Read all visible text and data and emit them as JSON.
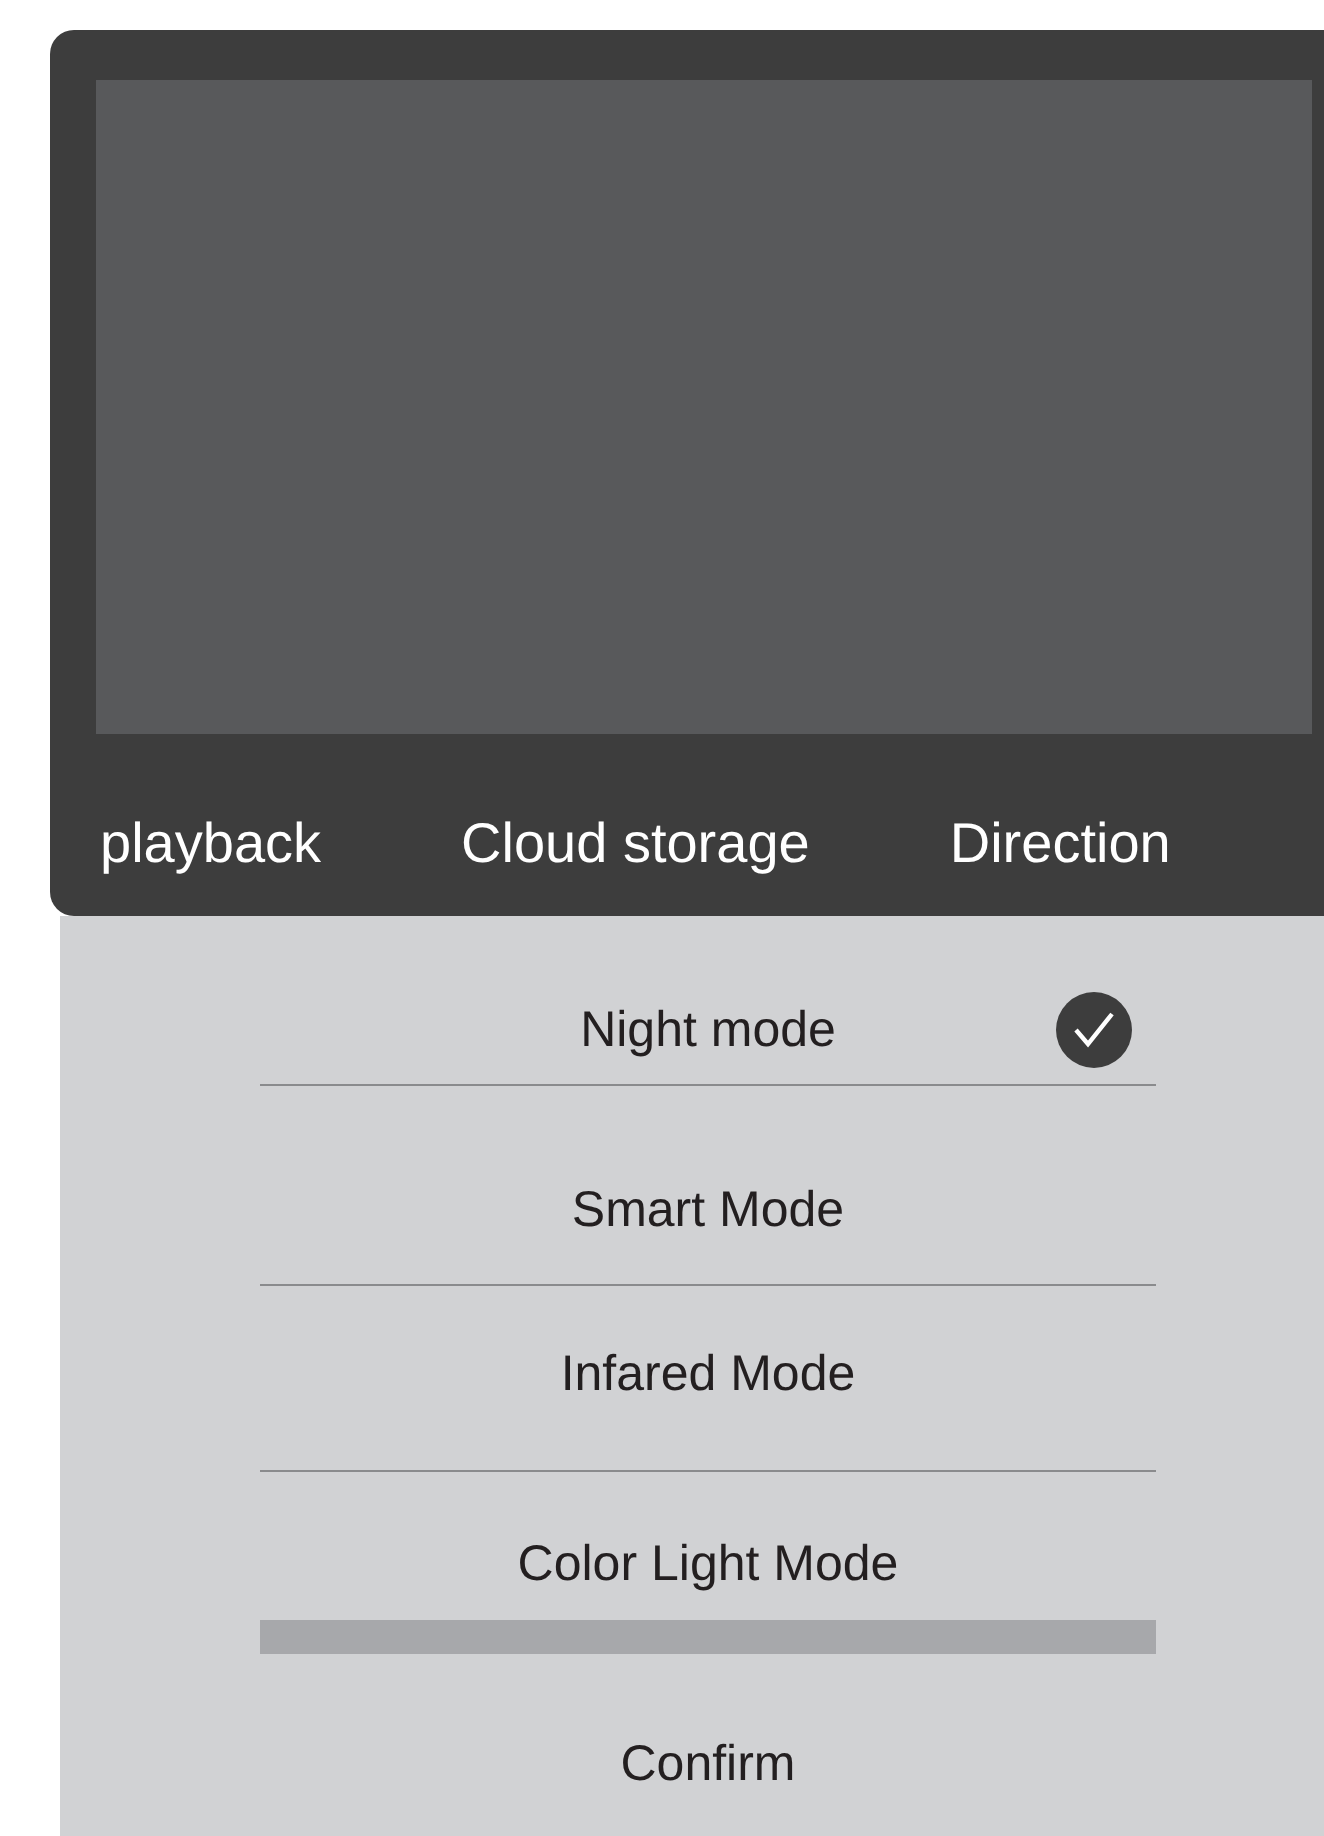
{
  "tabs": [
    {
      "label": "playback"
    },
    {
      "label": "Cloud storage"
    },
    {
      "label": "Direction"
    }
  ],
  "modes": [
    {
      "label": "Night mode",
      "selected": true
    },
    {
      "label": "Smart Mode",
      "selected": false
    },
    {
      "label": "Infared Mode",
      "selected": false
    },
    {
      "label": "Color Light Mode",
      "selected": false
    }
  ],
  "confirm_button": "Confirm"
}
